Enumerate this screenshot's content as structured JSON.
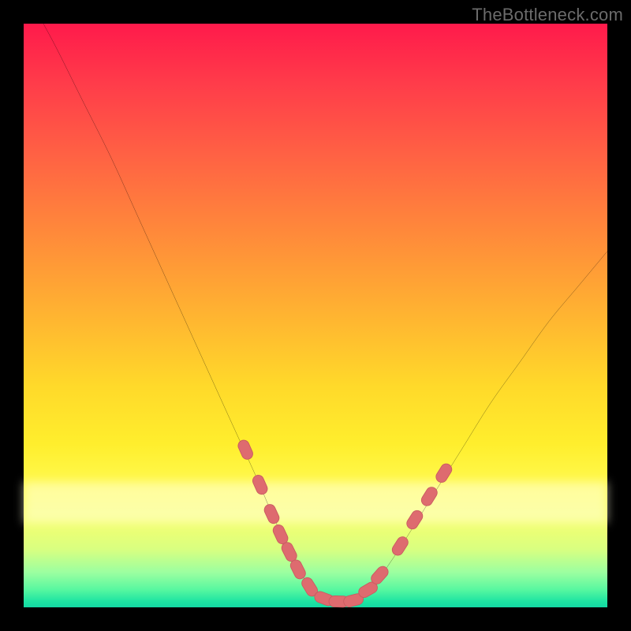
{
  "watermark": {
    "text": "TheBottleneck.com"
  },
  "colors": {
    "frame_bg": "#000000",
    "curve_stroke": "#000000",
    "marker_fill": "#de6b6f",
    "marker_stroke": "#c95b60"
  },
  "chart_data": {
    "type": "line",
    "title": "",
    "xlabel": "",
    "ylabel": "",
    "xlim": [
      0,
      100
    ],
    "ylim": [
      0,
      100
    ],
    "grid": false,
    "legend": null,
    "note": "Axis labels and numeric tick values are not shown in the image; curve and marker values are estimated from pixel positions on a normalized 0–100 × 0–100 plot area (origin at bottom-left).",
    "series": [
      {
        "name": "bottleneck-curve",
        "x": [
          0,
          5,
          10,
          15,
          20,
          25,
          30,
          35,
          40,
          43,
          46,
          48,
          50,
          52,
          54,
          56,
          58,
          60,
          62,
          65,
          70,
          75,
          80,
          85,
          90,
          95,
          100
        ],
        "y": [
          106,
          97,
          87,
          77,
          66,
          55,
          44,
          33,
          22,
          15,
          9,
          5,
          2.5,
          1.3,
          1.0,
          1.2,
          2.0,
          3.5,
          6.5,
          11,
          19,
          27,
          35,
          42,
          49,
          55,
          61
        ]
      }
    ],
    "markers": [
      {
        "x": 38.0,
        "y": 27.0
      },
      {
        "x": 40.5,
        "y": 21.0
      },
      {
        "x": 42.5,
        "y": 16.0
      },
      {
        "x": 44.0,
        "y": 12.5
      },
      {
        "x": 45.5,
        "y": 9.5
      },
      {
        "x": 47.0,
        "y": 6.5
      },
      {
        "x": 49.0,
        "y": 3.5
      },
      {
        "x": 51.5,
        "y": 1.5
      },
      {
        "x": 54.0,
        "y": 1.0
      },
      {
        "x": 56.5,
        "y": 1.2
      },
      {
        "x": 59.0,
        "y": 3.0
      },
      {
        "x": 61.0,
        "y": 5.5
      },
      {
        "x": 64.5,
        "y": 10.5
      },
      {
        "x": 67.0,
        "y": 15.0
      },
      {
        "x": 69.5,
        "y": 19.0
      },
      {
        "x": 72.0,
        "y": 23.0
      }
    ]
  }
}
